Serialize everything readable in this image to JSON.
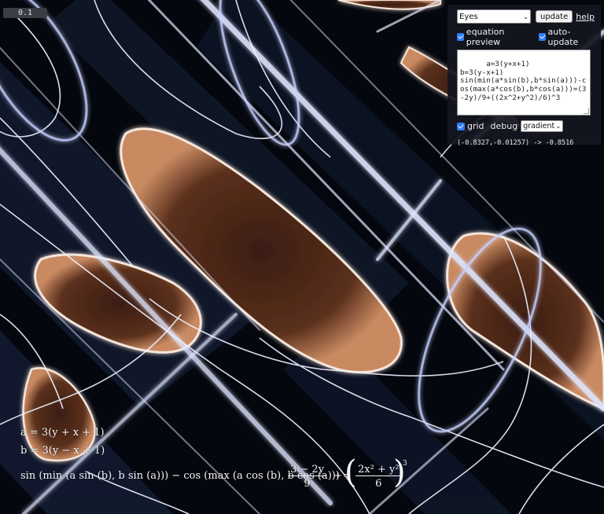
{
  "canvas": {
    "scale_readout": "0.1"
  },
  "panel": {
    "preset": {
      "selected": "Eyes"
    },
    "update_label": "update",
    "help_label": "help",
    "equation_preview_label": "equation preview",
    "auto_update_label": "auto-update",
    "equation_source": "a=3(y+x+1)\nb=3(y-x+1)\nsin(min(a*sin(b),b*sin(a)))-cos(max(a*cos(b),b*cos(a)))=(3-2y)/9+((2x^2+y^2)/6)^3",
    "grid_label": "grid",
    "debug_label": "debug",
    "debug_mode": "gradient",
    "cursor_readout": "(-0.8327,-0.01257) -> -0.8516"
  },
  "preview": {
    "line_a": "a = 3(y + x + 1)",
    "line_b": "b = 3(y − x + 1)",
    "main_lhs": "sin (min (a sin (b), b sin (a))) − cos (max (a cos (b), b cos (a))) =",
    "frac1_num": "3 − 2y",
    "frac1_den": "9",
    "plus": "+",
    "frac2_num": "2x² + y²",
    "frac2_den": "6",
    "exponent": "3"
  },
  "colors": {
    "background": "#06080f",
    "blue_glow": "#9fb4ff",
    "copper": "#5a2f1a",
    "panel_bg": "#141620",
    "checkbox": "#2f7cf6"
  }
}
